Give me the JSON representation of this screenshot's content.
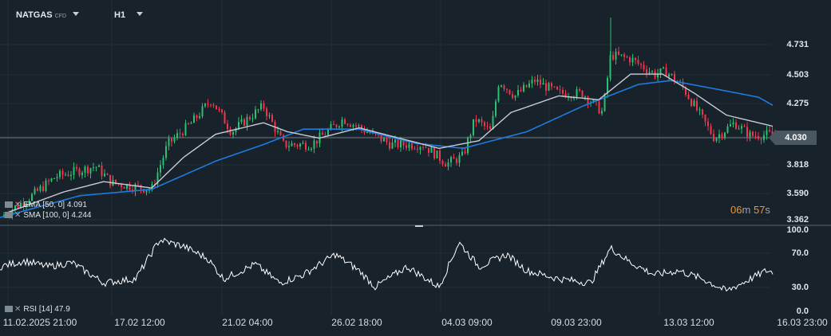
{
  "header": {
    "symbol": "NATGAS",
    "symbol_type": "CFD",
    "timeframe": "H1"
  },
  "indicators": {
    "ema": "EMA [50, 0] 4.091",
    "sma": "SMA [100, 0] 4.244",
    "rsi": "RSI [14] 47.9"
  },
  "current_price": "4.030",
  "timer": {
    "min": "06",
    "min_unit": "m",
    "sec": "57",
    "sec_unit": "s"
  },
  "colors": {
    "up": "#2fbf71",
    "down": "#f0364f",
    "ema": "#c8ccd8",
    "sma": "#1e7be0",
    "rsi": "#ffffff",
    "timer": "#f0962c"
  },
  "chart_data": {
    "type": "line",
    "title": "NATGAS CFD H1",
    "price_ticks": [
      "4.731",
      "4.503",
      "4.275",
      "4.030",
      "3.818",
      "3.590",
      "3.362"
    ],
    "price_range": [
      3.362,
      4.731
    ],
    "rsi_ticks": [
      "100.0",
      "70.0",
      "30.0",
      "0.0"
    ],
    "rsi_range": [
      0,
      100
    ],
    "x_ticks": [
      "11.02.2025  21:00",
      "17.02  12:00",
      "21.02  04:00",
      "26.02  18:00",
      "04.03  09:00",
      "09.03  23:00",
      "13.03  12:00",
      "16.03  23:00"
    ],
    "price_path": [
      [
        0,
        3.38
      ],
      [
        0.04,
        3.55
      ],
      [
        0.07,
        3.7
      ],
      [
        0.12,
        3.78
      ],
      [
        0.14,
        3.65
      ],
      [
        0.19,
        3.6
      ],
      [
        0.21,
        3.95
      ],
      [
        0.24,
        4.12
      ],
      [
        0.265,
        4.3
      ],
      [
        0.29,
        4.05
      ],
      [
        0.33,
        4.25
      ],
      [
        0.355,
        3.95
      ],
      [
        0.39,
        3.95
      ],
      [
        0.43,
        4.15
      ],
      [
        0.46,
        4.05
      ],
      [
        0.49,
        3.95
      ],
      [
        0.53,
        3.95
      ],
      [
        0.56,
        3.8
      ],
      [
        0.58,
        3.86
      ],
      [
        0.595,
        4.15
      ],
      [
        0.615,
        4.05
      ],
      [
        0.625,
        4.45
      ],
      [
        0.645,
        4.33
      ],
      [
        0.67,
        4.45
      ],
      [
        0.7,
        4.35
      ],
      [
        0.73,
        4.35
      ],
      [
        0.755,
        4.2
      ],
      [
        0.765,
        4.65
      ],
      [
        0.79,
        4.62
      ],
      [
        0.82,
        4.5
      ],
      [
        0.835,
        4.52
      ],
      [
        0.855,
        4.4
      ],
      [
        0.875,
        4.2
      ],
      [
        0.895,
        4.0
      ],
      [
        0.92,
        4.12
      ],
      [
        0.94,
        4.02
      ],
      [
        0.97,
        4.03
      ]
    ],
    "ema_path": [
      [
        0.01,
        3.42
      ],
      [
        0.08,
        3.58
      ],
      [
        0.13,
        3.66
      ],
      [
        0.19,
        3.61
      ],
      [
        0.23,
        3.85
      ],
      [
        0.27,
        4.03
      ],
      [
        0.33,
        4.12
      ],
      [
        0.36,
        4.05
      ],
      [
        0.4,
        4.0
      ],
      [
        0.45,
        4.08
      ],
      [
        0.5,
        4.0
      ],
      [
        0.55,
        3.92
      ],
      [
        0.6,
        3.98
      ],
      [
        0.64,
        4.2
      ],
      [
        0.7,
        4.33
      ],
      [
        0.75,
        4.3
      ],
      [
        0.79,
        4.5
      ],
      [
        0.83,
        4.5
      ],
      [
        0.87,
        4.35
      ],
      [
        0.91,
        4.18
      ],
      [
        0.97,
        4.09
      ]
    ],
    "sma_path": [
      [
        0.0,
        3.38
      ],
      [
        0.1,
        3.55
      ],
      [
        0.19,
        3.6
      ],
      [
        0.27,
        3.82
      ],
      [
        0.33,
        3.95
      ],
      [
        0.38,
        4.07
      ],
      [
        0.45,
        4.07
      ],
      [
        0.52,
        3.96
      ],
      [
        0.58,
        3.92
      ],
      [
        0.66,
        4.05
      ],
      [
        0.73,
        4.25
      ],
      [
        0.8,
        4.42
      ],
      [
        0.84,
        4.45
      ],
      [
        0.9,
        4.38
      ],
      [
        0.95,
        4.32
      ],
      [
        0.97,
        4.25
      ]
    ],
    "rsi_path": [
      [
        0.0,
        55
      ],
      [
        0.03,
        62
      ],
      [
        0.06,
        55
      ],
      [
        0.09,
        60
      ],
      [
        0.13,
        35
      ],
      [
        0.17,
        40
      ],
      [
        0.2,
        88
      ],
      [
        0.23,
        80
      ],
      [
        0.26,
        65
      ],
      [
        0.28,
        40
      ],
      [
        0.32,
        58
      ],
      [
        0.35,
        35
      ],
      [
        0.38,
        45
      ],
      [
        0.42,
        70
      ],
      [
        0.45,
        50
      ],
      [
        0.47,
        30
      ],
      [
        0.51,
        55
      ],
      [
        0.55,
        30
      ],
      [
        0.575,
        85
      ],
      [
        0.6,
        55
      ],
      [
        0.635,
        70
      ],
      [
        0.66,
        50
      ],
      [
        0.7,
        40
      ],
      [
        0.74,
        35
      ],
      [
        0.765,
        78
      ],
      [
        0.79,
        60
      ],
      [
        0.82,
        45
      ],
      [
        0.85,
        50
      ],
      [
        0.88,
        40
      ],
      [
        0.91,
        25
      ],
      [
        0.94,
        40
      ],
      [
        0.96,
        50
      ],
      [
        0.97,
        47.9
      ]
    ]
  }
}
